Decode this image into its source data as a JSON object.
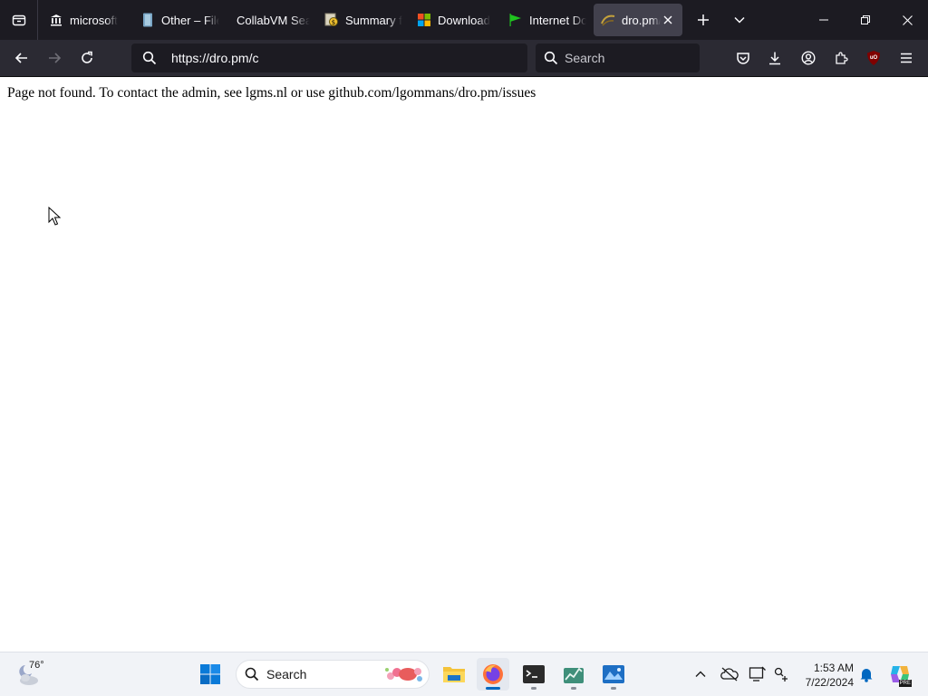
{
  "browser": {
    "tabs": [
      {
        "label": "microsoft",
        "icon": "museum-icon"
      },
      {
        "label": "Other – File",
        "icon": "file-icon"
      },
      {
        "label": "CollabVM Search",
        "icon": "none"
      },
      {
        "label": "Summary f",
        "icon": "summary-icon"
      },
      {
        "label": "Download",
        "icon": "windows-logo-icon"
      },
      {
        "label": "Internet Do",
        "icon": "green-flag-icon"
      },
      {
        "label": "dro.pm/",
        "icon": "dro-favicon",
        "active": true
      }
    ],
    "url": "https://dro.pm/c",
    "search_placeholder": "Search",
    "extension_badge": "uO"
  },
  "page": {
    "message": "Page not found. To contact the admin, see lgms.nl or use github.com/lgommans/dro.pm/issues"
  },
  "taskbar": {
    "weather_temp": "76°",
    "search_label": "Search",
    "apps": [
      "file-explorer-icon",
      "firefox-icon",
      "terminal-icon",
      "task-manager-icon",
      "photo-viewer-icon"
    ],
    "time": "1:53 AM",
    "date": "7/22/2024",
    "copilot_badge": "PRE"
  },
  "colors": {
    "tabstrip_bg": "#1c1b22",
    "navbar_bg": "#2b2a33",
    "urlbar_bg": "#1c1b22",
    "active_tab_bg": "#42414d",
    "taskbar_bg": "#f1f3f7",
    "accent_blue": "#0067c0"
  }
}
